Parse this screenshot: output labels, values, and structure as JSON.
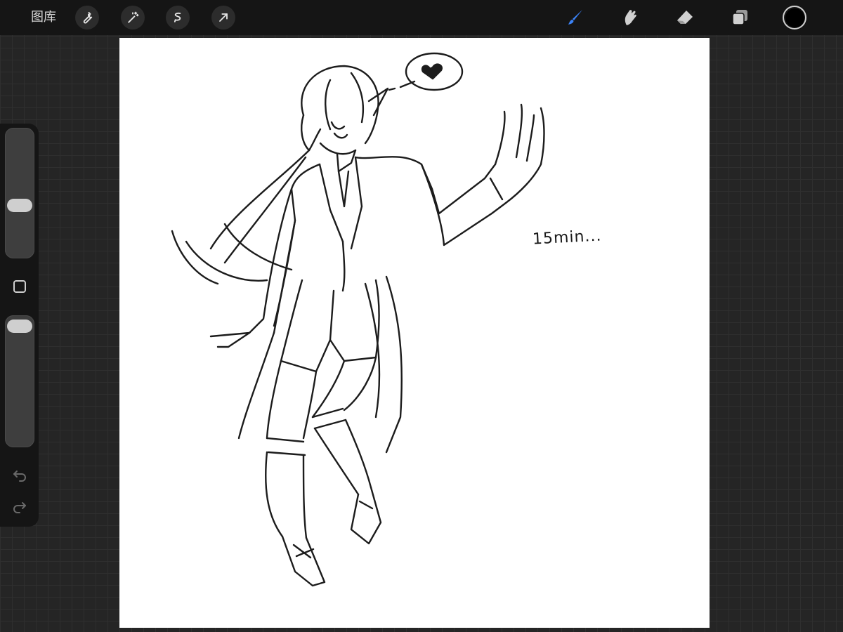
{
  "topbar": {
    "gallery_label": "图库",
    "left_tools": [
      {
        "icon": "wrench-icon",
        "name": "actions"
      },
      {
        "icon": "magic-wand-icon",
        "name": "adjustments"
      },
      {
        "icon": "selection-icon",
        "name": "selection"
      },
      {
        "icon": "transform-arrow-icon",
        "name": "transform"
      }
    ],
    "right_tools": [
      {
        "icon": "brush-icon",
        "name": "paint",
        "active": true
      },
      {
        "icon": "smudge-icon",
        "name": "smudge",
        "active": false
      },
      {
        "icon": "eraser-icon",
        "name": "erase",
        "active": false
      },
      {
        "icon": "layers-icon",
        "name": "layers",
        "active": false
      }
    ],
    "current_color": "#000000"
  },
  "sidebar": {
    "brush_size_level": 0.39,
    "opacity_level": 0.98
  },
  "canvas": {
    "note_text": "15min..."
  },
  "colors": {
    "accent": "#3b82f6",
    "topbar_bg": "#151515",
    "workspace_bg": "#252525"
  }
}
